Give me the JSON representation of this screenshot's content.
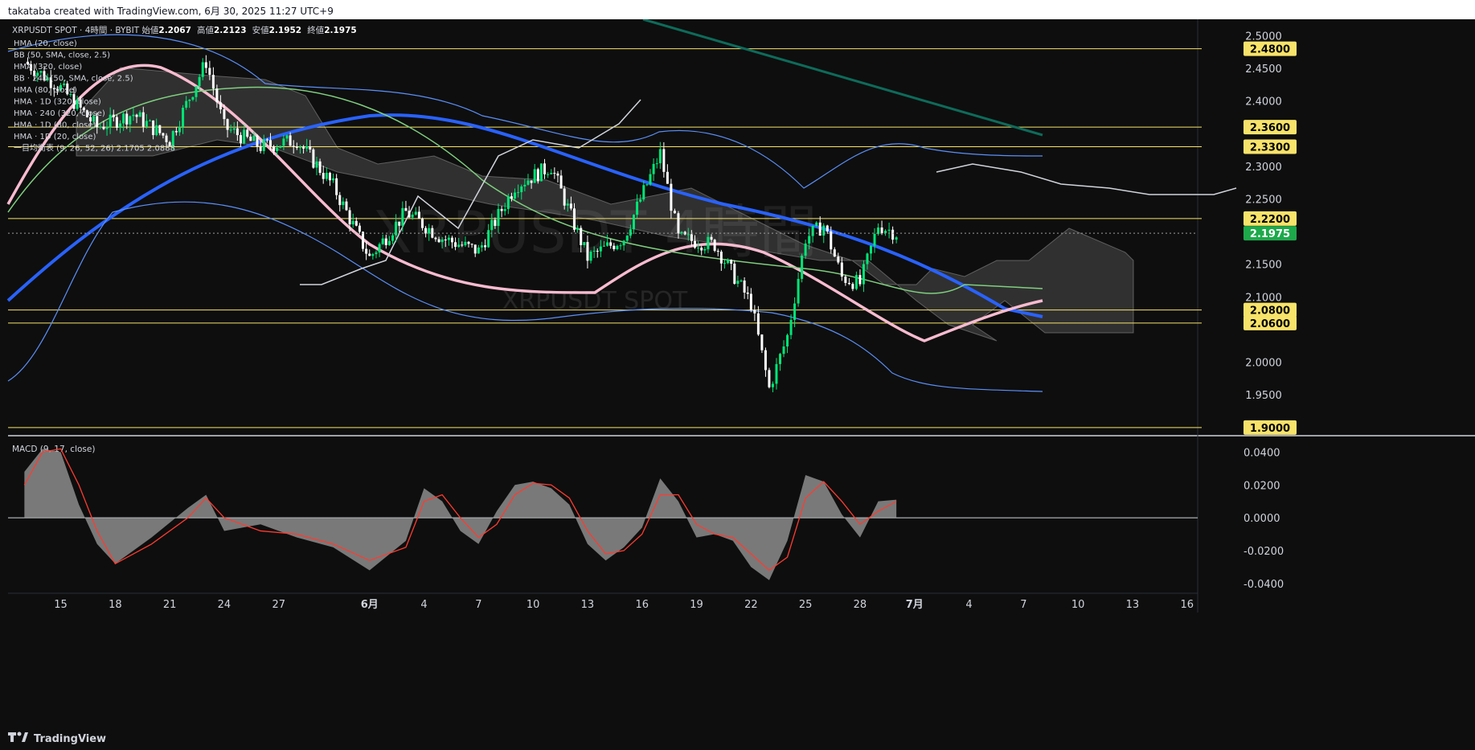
{
  "header": {
    "created_by": "takataba created with TradingView.com, 6月 30, 2025 11:27 UTC+9"
  },
  "legend": {
    "symbol": "XRPUSDT SPOT · 4時間 · BYBIT",
    "ohlc": [
      {
        "label": "始値",
        "value": "2.2067"
      },
      {
        "label": "高値",
        "value": "2.2123"
      },
      {
        "label": "安値",
        "value": "2.1952"
      },
      {
        "label": "終値",
        "value": "2.1975"
      }
    ],
    "indicators": [
      "HMA (20, close)",
      "BB (50, SMA, close, 2.5)",
      "HMA (320, close)",
      "BB · 240 (50, SMA, close, 2.5)",
      "HMA (80, close)",
      "HMA · 1D (320, close)",
      "HMA · 240 (320, close)",
      "HMA · 1D (80, close)",
      "HMA · 1D (20, close)",
      "一目均衡表 (9, 26, 52, 26)   2.1705   2.0888"
    ]
  },
  "watermark": {
    "title": "XRPUSDT 4時間",
    "subtitle": "XRPUSDT SPOT"
  },
  "macd_legend": "MACD (9, 17, close)",
  "brand": "TradingView",
  "colors": {
    "background": "#0e0e0e",
    "bull_candle": "#00e676",
    "bear_candle": "#ffffff",
    "hline": "#f7e36a",
    "hma_blue": "#2962ff",
    "hma_pink": "#f8bbd0",
    "bb_blue": "#5b8ff9",
    "ichimoku_green": "#7fcf7f",
    "trendline": "#0e6b5a",
    "macd_hist": "#9e9e9e",
    "macd_signal": "#ff3b30",
    "last_price_tag": "#1ea94b"
  },
  "chart_data": [
    {
      "type": "candlestick",
      "name": "XRPUSDT price (4h)",
      "ylim": [
        1.89,
        2.525
      ],
      "yticks": [
        "2.5000",
        "2.4500",
        "2.4000",
        "2.3000",
        "2.2500",
        "2.1500",
        "2.1000",
        "2.0000",
        "1.9500"
      ],
      "x_ticks": [
        "15",
        "18",
        "21",
        "24",
        "27",
        "6月",
        "4",
        "7",
        "10",
        "13",
        "16",
        "19",
        "22",
        "25",
        "28",
        "7月",
        "4",
        "7",
        "10",
        "13",
        "16"
      ],
      "horizontal_levels": [
        "2.4800",
        "2.3600",
        "2.3300",
        "2.2200",
        "2.0800",
        "2.0600",
        "1.9000"
      ],
      "last_price": "2.1975",
      "ohlc_last": {
        "open": 2.2067,
        "high": 2.2123,
        "low": 2.1952,
        "close": 2.1975
      },
      "ichimoku_values": [
        "2.1705",
        "2.0888"
      ],
      "close_path": [
        {
          "date": "05-13",
          "close": 2.46
        },
        {
          "date": "05-15",
          "close": 2.42
        },
        {
          "date": "05-17",
          "close": 2.36
        },
        {
          "date": "05-19",
          "close": 2.38
        },
        {
          "date": "05-21",
          "close": 2.34
        },
        {
          "date": "05-23",
          "close": 2.46
        },
        {
          "date": "05-24",
          "close": 2.36
        },
        {
          "date": "05-26",
          "close": 2.33
        },
        {
          "date": "05-28",
          "close": 2.34
        },
        {
          "date": "05-30",
          "close": 2.27
        },
        {
          "date": "06-01",
          "close": 2.16
        },
        {
          "date": "06-03",
          "close": 2.23
        },
        {
          "date": "06-05",
          "close": 2.19
        },
        {
          "date": "06-07",
          "close": 2.17
        },
        {
          "date": "06-09",
          "close": 2.27
        },
        {
          "date": "06-11",
          "close": 2.3
        },
        {
          "date": "06-13",
          "close": 2.16
        },
        {
          "date": "06-15",
          "close": 2.19
        },
        {
          "date": "06-17",
          "close": 2.32
        },
        {
          "date": "06-18",
          "close": 2.19
        },
        {
          "date": "06-20",
          "close": 2.18
        },
        {
          "date": "06-22",
          "close": 2.09
        },
        {
          "date": "06-23",
          "close": 1.96
        },
        {
          "date": "06-24",
          "close": 2.04
        },
        {
          "date": "06-25",
          "close": 2.19
        },
        {
          "date": "06-26",
          "close": 2.21
        },
        {
          "date": "06-27",
          "close": 2.13
        },
        {
          "date": "06-28",
          "close": 2.12
        },
        {
          "date": "06-29",
          "close": 2.21
        },
        {
          "date": "06-30",
          "close": 2.1975
        }
      ]
    },
    {
      "type": "area",
      "name": "MACD (9, 17, close)",
      "ylim": [
        -0.045,
        0.05
      ],
      "yticks": [
        "0.0400",
        "0.0200",
        "0.0000",
        "-0.0200",
        "-0.0400"
      ],
      "macd": [
        {
          "date": "05-13",
          "value": 0.028
        },
        {
          "date": "05-14",
          "value": 0.042
        },
        {
          "date": "05-15",
          "value": 0.04
        },
        {
          "date": "05-16",
          "value": 0.008
        },
        {
          "date": "05-17",
          "value": -0.016
        },
        {
          "date": "05-18",
          "value": -0.028
        },
        {
          "date": "05-20",
          "value": -0.012
        },
        {
          "date": "05-22",
          "value": 0.006
        },
        {
          "date": "05-23",
          "value": 0.014
        },
        {
          "date": "05-24",
          "value": -0.008
        },
        {
          "date": "05-26",
          "value": -0.004
        },
        {
          "date": "05-28",
          "value": -0.012
        },
        {
          "date": "05-30",
          "value": -0.018
        },
        {
          "date": "06-01",
          "value": -0.032
        },
        {
          "date": "06-03",
          "value": -0.014
        },
        {
          "date": "06-04",
          "value": 0.018
        },
        {
          "date": "06-05",
          "value": 0.01
        },
        {
          "date": "06-06",
          "value": -0.008
        },
        {
          "date": "06-07",
          "value": -0.016
        },
        {
          "date": "06-08",
          "value": 0.004
        },
        {
          "date": "06-09",
          "value": 0.02
        },
        {
          "date": "06-10",
          "value": 0.022
        },
        {
          "date": "06-11",
          "value": 0.018
        },
        {
          "date": "06-12",
          "value": 0.008
        },
        {
          "date": "06-13",
          "value": -0.016
        },
        {
          "date": "06-14",
          "value": -0.026
        },
        {
          "date": "06-15",
          "value": -0.018
        },
        {
          "date": "06-16",
          "value": -0.006
        },
        {
          "date": "06-17",
          "value": 0.024
        },
        {
          "date": "06-18",
          "value": 0.01
        },
        {
          "date": "06-19",
          "value": -0.012
        },
        {
          "date": "06-20",
          "value": -0.01
        },
        {
          "date": "06-21",
          "value": -0.014
        },
        {
          "date": "06-22",
          "value": -0.03
        },
        {
          "date": "06-23",
          "value": -0.038
        },
        {
          "date": "06-24",
          "value": -0.014
        },
        {
          "date": "06-25",
          "value": 0.026
        },
        {
          "date": "06-26",
          "value": 0.022
        },
        {
          "date": "06-27",
          "value": 0.002
        },
        {
          "date": "06-28",
          "value": -0.012
        },
        {
          "date": "06-29",
          "value": 0.01
        },
        {
          "date": "06-30",
          "value": 0.011
        }
      ],
      "signal": [
        {
          "date": "05-13",
          "value": 0.02
        },
        {
          "date": "05-14",
          "value": 0.04
        },
        {
          "date": "05-15",
          "value": 0.042
        },
        {
          "date": "05-16",
          "value": 0.02
        },
        {
          "date": "05-17",
          "value": -0.008
        },
        {
          "date": "05-18",
          "value": -0.028
        },
        {
          "date": "05-20",
          "value": -0.016
        },
        {
          "date": "05-22",
          "value": 0.0
        },
        {
          "date": "05-23",
          "value": 0.012
        },
        {
          "date": "05-24",
          "value": 0.0
        },
        {
          "date": "05-26",
          "value": -0.008
        },
        {
          "date": "05-28",
          "value": -0.01
        },
        {
          "date": "05-30",
          "value": -0.016
        },
        {
          "date": "06-01",
          "value": -0.026
        },
        {
          "date": "06-03",
          "value": -0.018
        },
        {
          "date": "06-04",
          "value": 0.01
        },
        {
          "date": "06-05",
          "value": 0.014
        },
        {
          "date": "06-06",
          "value": 0.0
        },
        {
          "date": "06-07",
          "value": -0.012
        },
        {
          "date": "06-08",
          "value": -0.004
        },
        {
          "date": "06-09",
          "value": 0.014
        },
        {
          "date": "06-10",
          "value": 0.021
        },
        {
          "date": "06-11",
          "value": 0.02
        },
        {
          "date": "06-12",
          "value": 0.012
        },
        {
          "date": "06-13",
          "value": -0.008
        },
        {
          "date": "06-14",
          "value": -0.022
        },
        {
          "date": "06-15",
          "value": -0.02
        },
        {
          "date": "06-16",
          "value": -0.01
        },
        {
          "date": "06-17",
          "value": 0.014
        },
        {
          "date": "06-18",
          "value": 0.014
        },
        {
          "date": "06-19",
          "value": -0.004
        },
        {
          "date": "06-20",
          "value": -0.01
        },
        {
          "date": "06-21",
          "value": -0.012
        },
        {
          "date": "06-22",
          "value": -0.022
        },
        {
          "date": "06-23",
          "value": -0.032
        },
        {
          "date": "06-24",
          "value": -0.024
        },
        {
          "date": "06-25",
          "value": 0.012
        },
        {
          "date": "06-26",
          "value": 0.022
        },
        {
          "date": "06-27",
          "value": 0.01
        },
        {
          "date": "06-28",
          "value": -0.004
        },
        {
          "date": "06-29",
          "value": 0.004
        },
        {
          "date": "06-30",
          "value": 0.01
        }
      ]
    }
  ]
}
